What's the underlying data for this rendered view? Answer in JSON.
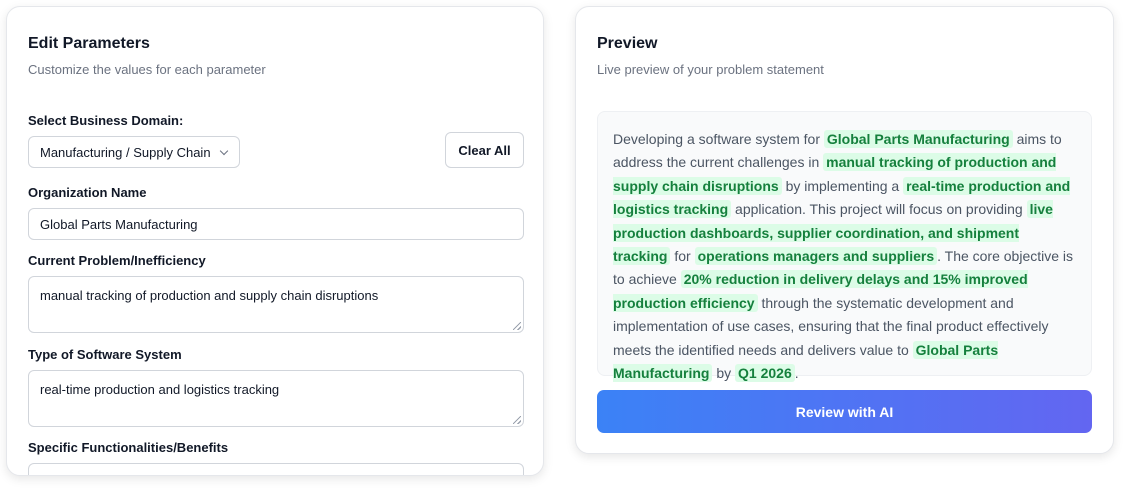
{
  "edit": {
    "title": "Edit Parameters",
    "subtitle": "Customize the values for each parameter",
    "domain_label": "Select Business Domain:",
    "domain_value": "Manufacturing / Supply Chain",
    "clear_all": "Clear All",
    "org_label": "Organization Name",
    "org_value": "Global Parts Manufacturing",
    "problem_label": "Current Problem/Inefficiency",
    "problem_value": "manual tracking of production and supply chain disruptions",
    "software_label": "Type of Software System",
    "software_value": "real-time production and logistics tracking",
    "func_label": "Specific Functionalities/Benefits"
  },
  "preview": {
    "title": "Preview",
    "subtitle": "Live preview of your problem statement",
    "t1": "Developing a software system for ",
    "h1": "Global Parts Manufacturing",
    "t2": " aims to address the current challenges in ",
    "h2": "manual tracking of production and supply chain disruptions",
    "t3": " by implementing a ",
    "h3": "real-time production and logistics tracking",
    "t4": " application. This project will focus on providing ",
    "h4": "live production dashboards, supplier coordination, and shipment tracking",
    "t5": " for ",
    "h5": "operations managers and suppliers",
    "t6": ". The core objective is to achieve ",
    "h6": "20% reduction in delivery delays and 15% improved production efficiency",
    "t7": " through the systematic development and implementation of use cases, ensuring that the final product effectively meets the identified needs and delivers value to ",
    "h7": "Global Parts Manufacturing",
    "t8": " by ",
    "h8": "Q1 2026",
    "t9": ".",
    "review_button": "Review with AI"
  },
  "colors": {
    "highlight_bg": "#dcfce7",
    "highlight_text": "#15803d",
    "button_gradient_start": "#3b82f6",
    "button_gradient_end": "#6366f1"
  }
}
